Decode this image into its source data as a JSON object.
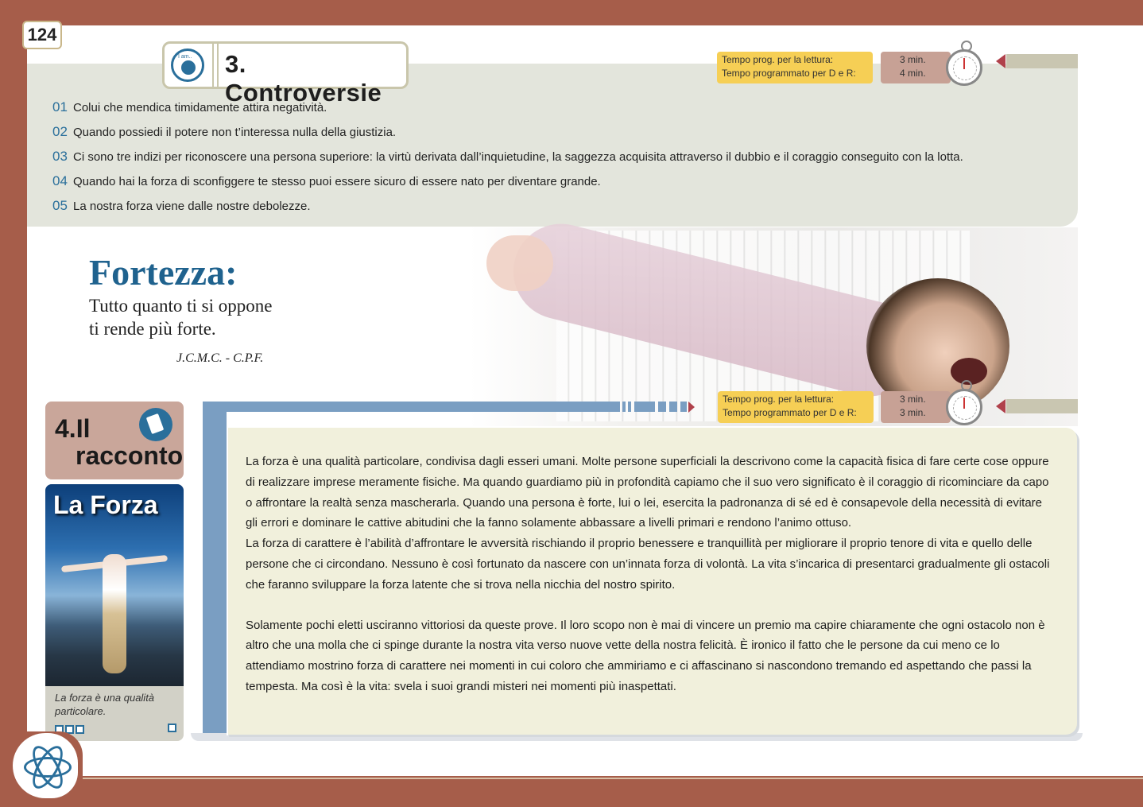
{
  "page": {
    "number": "124"
  },
  "section3": {
    "tab_icon_label": "I am..",
    "title": "3. Controversie",
    "timer": {
      "label_read": "Tempo prog. per la lettura:",
      "label_dr": "Tempo programmato per D e R:",
      "min_read": "3 min.",
      "min_dr": "4 min."
    },
    "quotes": [
      {
        "n": "01",
        "text": "Colui che mendica timidamente attira negatività."
      },
      {
        "n": "02",
        "text": "Quando possiedi il potere non t’interessa nulla della giustizia."
      },
      {
        "n": "03",
        "text": "Ci sono tre indizi per riconoscere una persona superiore: la virtù derivata dall’inquietudine, la saggezza acquisita attraverso il dubbio e il coraggio conseguito con la lotta."
      },
      {
        "n": "04",
        "text": "Quando hai la forza di sconfiggere te stesso puoi essere sicuro di essere nato per diventare grande."
      },
      {
        "n": "05",
        "text": "La nostra forza viene dalle nostre debolezze."
      }
    ]
  },
  "fortezza": {
    "title": "Fortezza:",
    "line1": "Tutto quanto ti si oppone",
    "line2": "ti rende più forte.",
    "author": "J.C.M.C. - C.P.F."
  },
  "section4": {
    "num": "4.Il",
    "word": "racconto",
    "timer": {
      "label_read": "Tempo prog. per la lettura:",
      "label_dr": "Tempo programmato per D e R:",
      "min_read": "3 min.",
      "min_dr": "3 min."
    },
    "card": {
      "title": "La Forza",
      "caption": "La forza è una qualità particolare."
    },
    "paragraphs": [
      "La forza è una qualità particolare, condivisa dagli esseri umani. Molte persone superficiali la descrivono come la capacità fisica di fare certe cose oppure di realizzare imprese meramente fisiche. Ma quando guardiamo più in profondità capiamo che il suo vero significato è il coraggio di ricominciare da capo o affrontare la realtà senza mascherarla. Quando una persona è forte, lui o lei, esercita la padronanza di sé ed è consapevole della necessità di evitare gli errori e dominare le cattive abitudini che la fanno solamente abbassare a livelli primari e rendono l’animo ottuso.",
      "La forza di carattere è l’abilità d’affrontare le avversità rischiando il proprio benessere e tranquillità per migliorare il proprio tenore di vita e quello delle persone che ci circondano. Nessuno è così fortunato da nascere con un’innata forza di volontà. La vita s’incarica di presentarci gradualmente gli ostacoli che faranno sviluppare la forza latente che si trova nella nicchia del nostro spirito.",
      "Solamente pochi eletti usciranno vittoriosi da queste prove. Il loro scopo non è mai di vincere un premio ma capire chiaramente che ogni ostacolo non è altro che una molla che ci spinge durante la nostra vita verso nuove vette della nostra felicità. È ironico il fatto che le persone da cui meno ce lo attendiamo mostrino forza di carattere nei momenti in cui coloro che ammiriamo e ci affascinano si nascondono tremando ed aspettando che passi la tempesta. Ma così è la vita: svela i suoi grandi misteri nei momenti più inaspettati."
    ]
  },
  "colors": {
    "frame": "#a65d4a",
    "accent_blue": "#2a6f9b",
    "timer_yellow": "#f6cf55"
  }
}
